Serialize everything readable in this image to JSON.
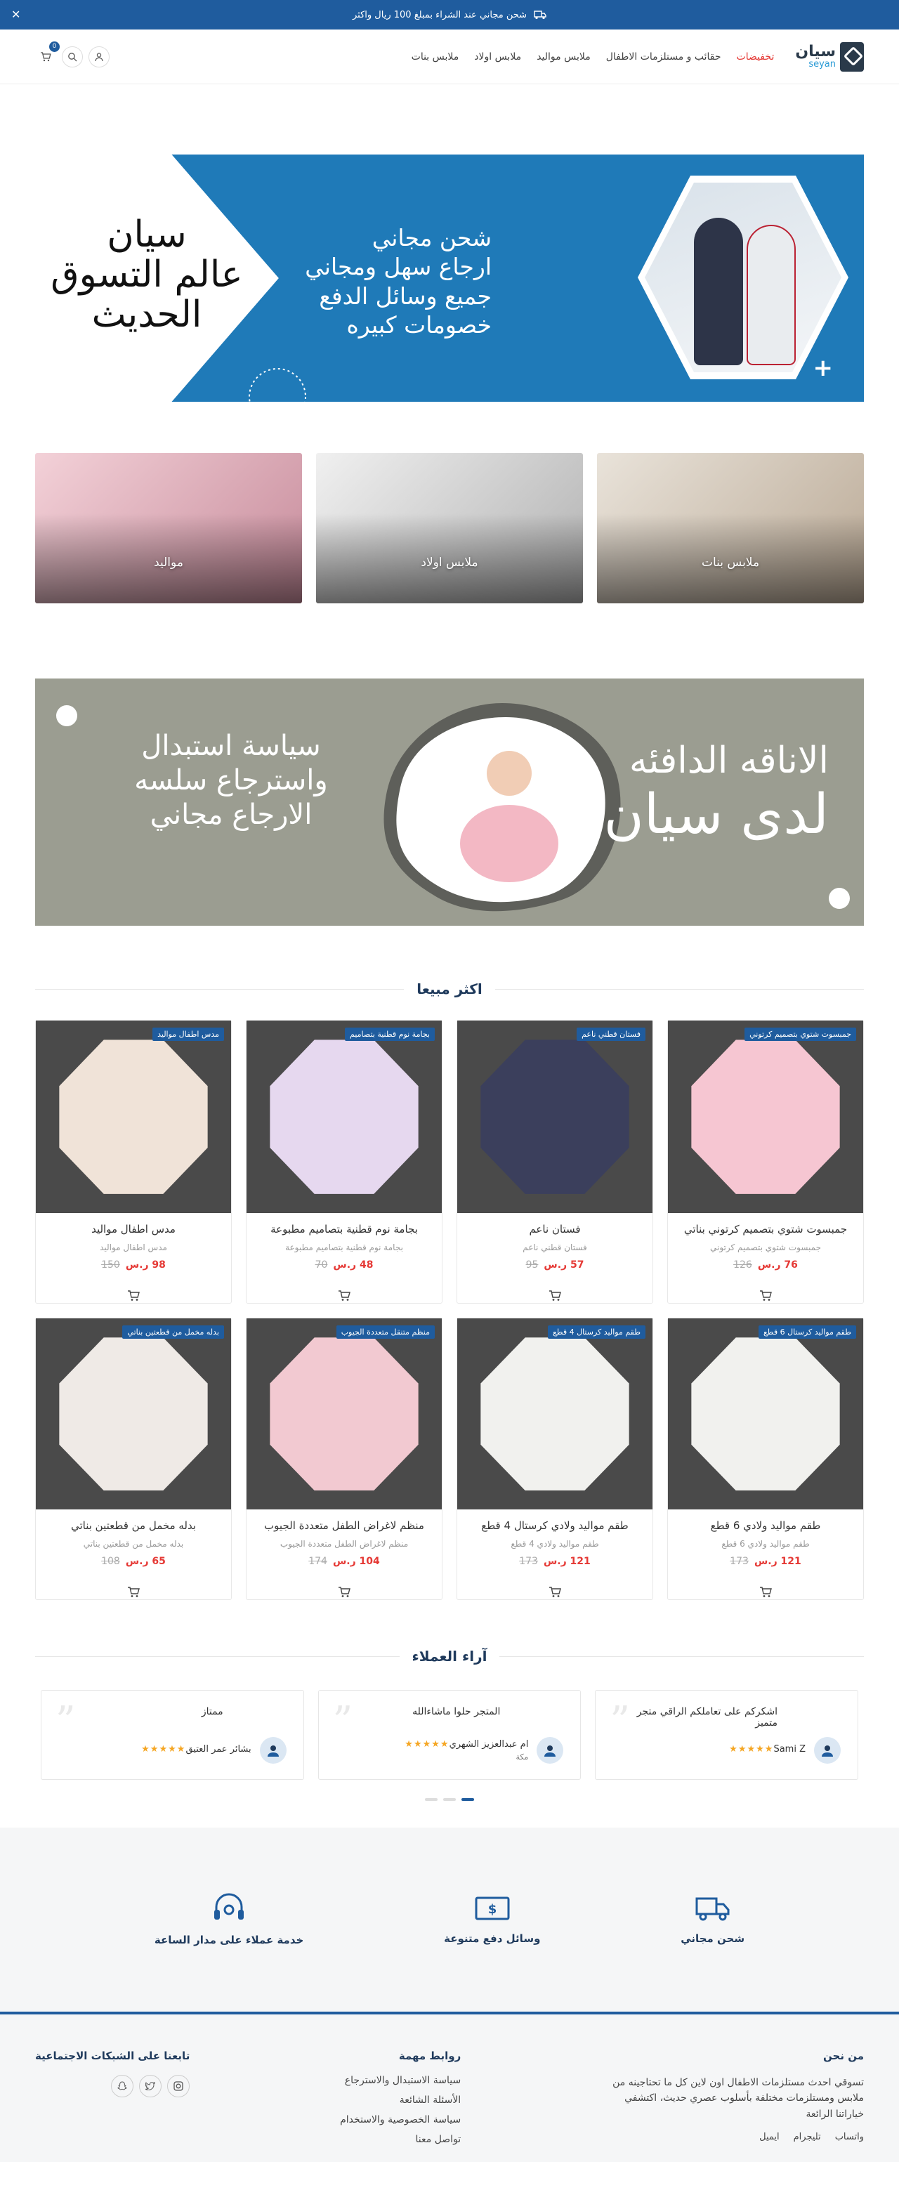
{
  "topbar": {
    "message": "شحن مجاني عند الشراء بمبلغ 100 ريال واكثر",
    "close": "✕"
  },
  "header": {
    "logo_ar": "سيان",
    "logo_en": "seyan",
    "nav": [
      "تخفيضات",
      "حقائب و مستلزمات الاطفال",
      "ملابس مواليد",
      "ملابس اولاد",
      "ملابس بنات"
    ],
    "cart_count": "0"
  },
  "hero": {
    "lines": [
      "شحن مجاني",
      "ارجاع سهل ومجاني",
      "جميع وسائل الدفع",
      "خصومات كبيره"
    ],
    "left": [
      "سيان",
      "عالم التسوق",
      "الحديث"
    ]
  },
  "categories": [
    {
      "label": "ملابس بنات",
      "color": "#cdbfae"
    },
    {
      "label": "ملابس اولاد",
      "color": "#c4c4c4"
    },
    {
      "label": "مواليد",
      "color": "#d8b1b8"
    }
  ],
  "promo": {
    "right1": "الاناقه الدافئه",
    "right2": "لدى سيان",
    "left": [
      "سياسة استبدال",
      "واسترجاع سلسه",
      "الارجاع مجاني"
    ]
  },
  "bestsellers": {
    "title": "اكثر مبيعا",
    "currency": "ر.س",
    "products": [
      {
        "tag": "جمبسوت شتوي بتصميم كرتوني",
        "name": "جمبسوت شتوي بتصميم كرتوني بناتي",
        "sub": "جمبسوت شتوي بتصميم كرتوني",
        "new": "76 ر.س",
        "old": "126"
      },
      {
        "tag": "فستان قطني ناعم",
        "name": "فستان ناعم",
        "sub": "فستان قطني ناعم",
        "new": "57 ر.س",
        "old": "95"
      },
      {
        "tag": "بجامة نوم قطنية بتصاميم",
        "name": "بجامة نوم قطنية بتصاميم مطبوعة",
        "sub": "بجامة نوم قطنية بتصاميم مطبوعة",
        "new": "48 ر.س",
        "old": "70"
      },
      {
        "tag": "مدس اطفال مواليد",
        "name": "مدس اطفال مواليد",
        "sub": "مدس اطفال مواليد",
        "new": "98 ر.س",
        "old": "150"
      },
      {
        "tag": "طقم مواليد كرستال 6 قطع",
        "name": "طقم مواليد ولادي 6 قطع",
        "sub": "طقم مواليد ولادي 6 قطع",
        "new": "121 ر.س",
        "old": "173"
      },
      {
        "tag": "طقم مواليد كرستال 4 قطع",
        "name": "طقم مواليد ولادي كرستال 4 قطع",
        "sub": "طقم مواليد ولادي 4 قطع",
        "new": "121 ر.س",
        "old": "173"
      },
      {
        "tag": "منظم متنقل متعددة الجيوب",
        "name": "منظم لاغراض الطفل متعددة الجيوب",
        "sub": "منظم لاغراض الطفل متعددة الجيوب",
        "new": "104 ر.س",
        "old": "174"
      },
      {
        "tag": "بدله مخمل من قطعتين بناتي",
        "name": "بدله مخمل من قطعتين بناتي",
        "sub": "بدله مخمل من قطعتين بناتي",
        "new": "65 ر.س",
        "old": "108"
      }
    ]
  },
  "reviews": {
    "title": "آراء العملاء",
    "items": [
      {
        "text": "اشكركم على تعاملكم الراقي متجر متميز",
        "name": "Sami Z",
        "city": ""
      },
      {
        "text": "المتجر حلوا ماشاءالله",
        "name": "ام عبدالعزيز الشهري",
        "city": "مكة"
      },
      {
        "text": "ممتاز",
        "name": "بشائر عمر العتيق",
        "city": ""
      }
    ],
    "stars": "★★★★★"
  },
  "features": [
    "شحن مجاني",
    "وسائل دفع متنوعة",
    "خدمة عملاء على مدار الساعة"
  ],
  "footer": {
    "about_title": "من نحن",
    "about_text": "تسوقي احدث مستلزمات الاطفال اون لاين كل ما تحتاجينه من ملابس ومستلزمات مختلفة بأسلوب عصري حديث، اكتشفي خياراتنا الرائعة",
    "contacts": [
      "واتساب",
      "تليجرام",
      "ايميل"
    ],
    "links_title": "روابط مهمة",
    "links": [
      "سياسة الاستبدال والاسترجاع",
      "الأسئلة الشائعة",
      "سياسة الخصوصية والاستخدام",
      "تواصل معنا"
    ],
    "social_title": "تابعنا على الشبكات الاجتماعية"
  },
  "colors": {
    "brand": "#1f5c9e",
    "hero": "#1f7ab8",
    "promo": "#9b9d91",
    "sale": "#e53935"
  }
}
